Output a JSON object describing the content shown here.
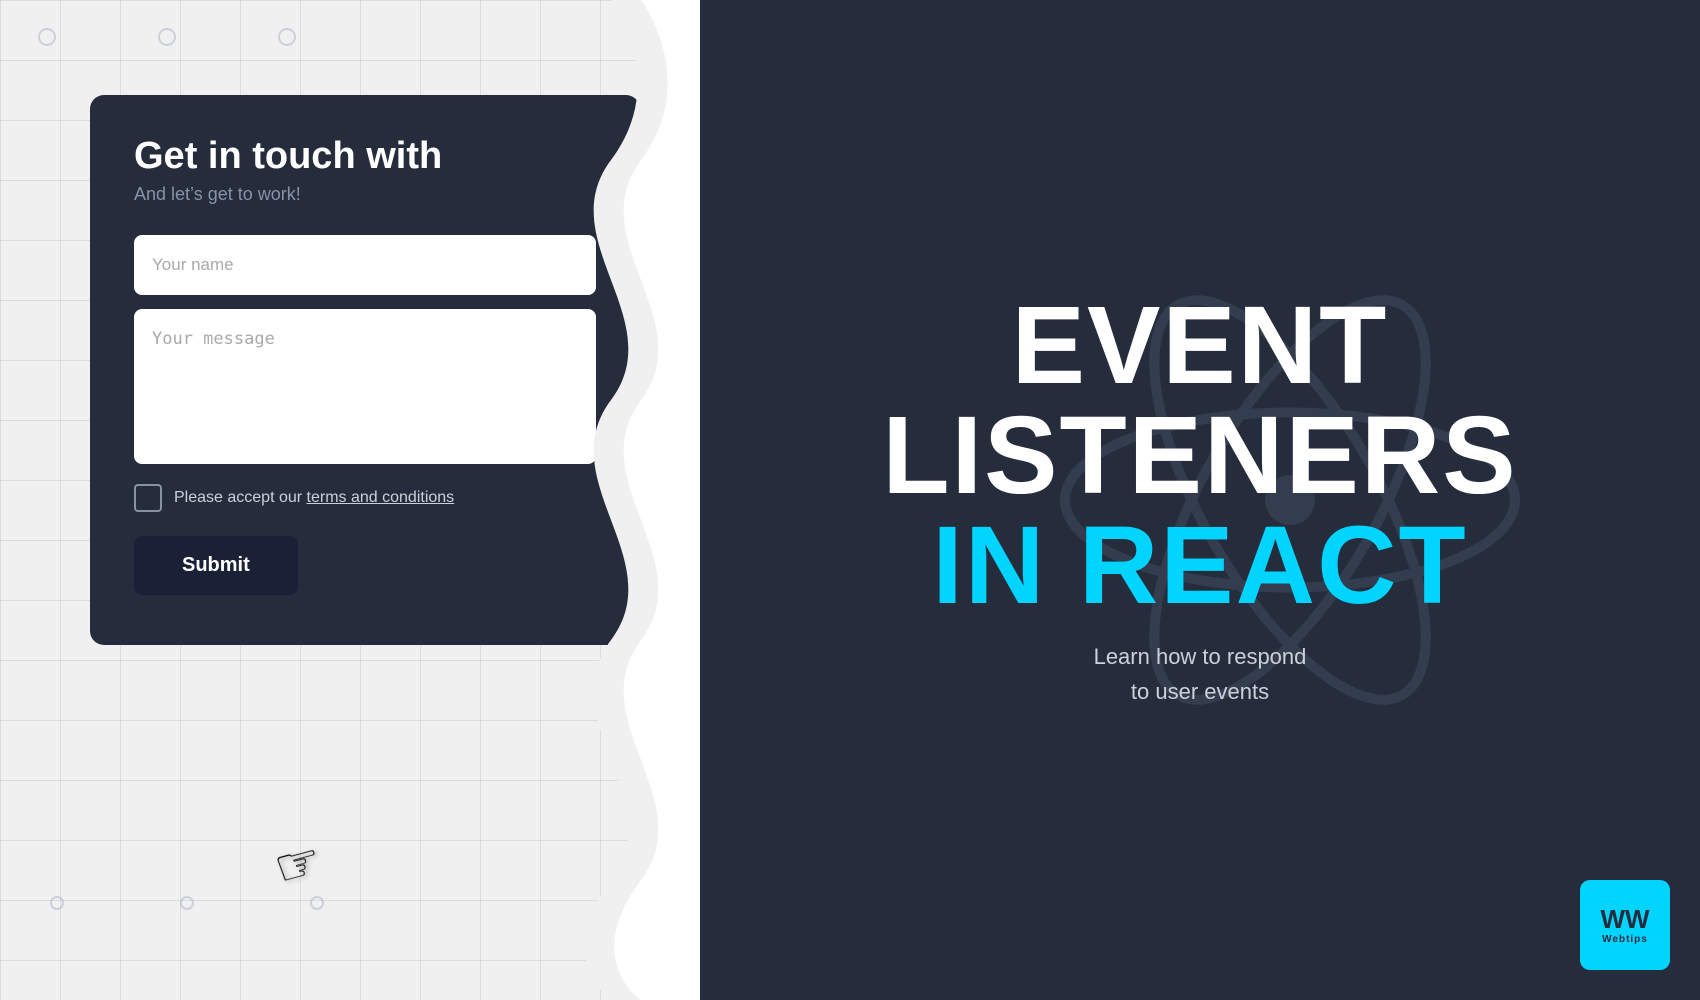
{
  "left": {
    "form": {
      "title": "Get in touch with",
      "subtitle": "And let’s get to work!",
      "name_placeholder": "Your name",
      "message_placeholder": "Your message",
      "checkbox_label": "Please accept our ",
      "checkbox_link": "terms and conditions",
      "submit_label": "Submit"
    }
  },
  "right": {
    "line1": "EVENT",
    "line2": "LISTENERS",
    "line3": "IN REACT",
    "sub1": "Learn how to respond",
    "sub2": "to user events"
  },
  "webtips": {
    "ww": "WW",
    "label": "Webtips"
  },
  "icons": {
    "cursor": "☛"
  }
}
